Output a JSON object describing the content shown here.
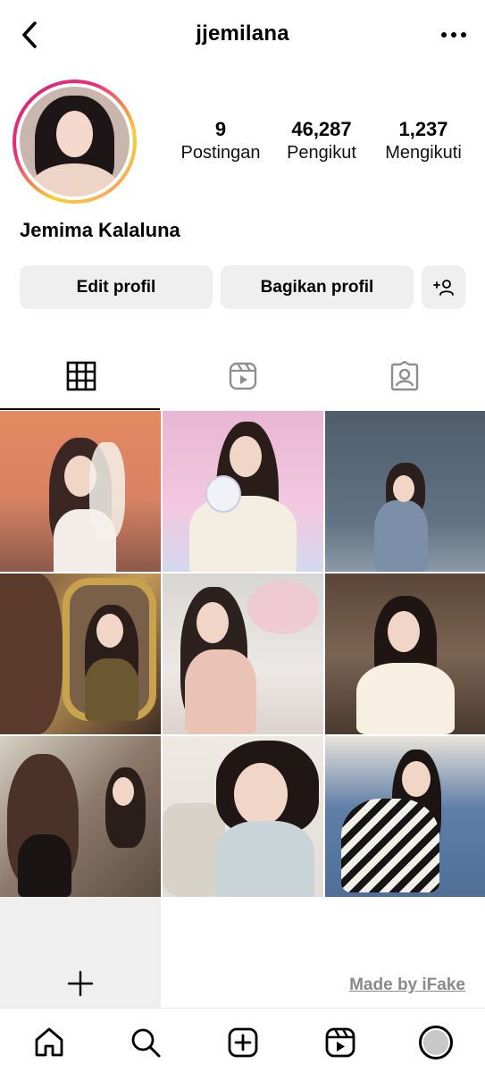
{
  "header": {
    "username": "jjemilana",
    "back_icon": "chevron-left-icon",
    "more_icon": "more-horizontal-icon"
  },
  "profile": {
    "full_name": "Jemima Kalaluna",
    "has_story_ring": true,
    "stats": {
      "posts": {
        "value": "9",
        "label": "Postingan"
      },
      "followers": {
        "value": "46,287",
        "label": "Pengikut"
      },
      "following": {
        "value": "1,237",
        "label": "Mengikuti"
      }
    }
  },
  "actions": {
    "edit_label": "Edit profil",
    "share_label": "Bagikan profil",
    "add_user_icon": "add-user-icon"
  },
  "tabs": [
    {
      "name": "posts",
      "icon": "grid-icon",
      "active": true
    },
    {
      "name": "reels",
      "icon": "reels-icon",
      "active": false
    },
    {
      "name": "tagged",
      "icon": "tagged-icon",
      "active": false
    }
  ],
  "posts": [
    {
      "index": 1,
      "description": "photo"
    },
    {
      "index": 2,
      "description": "photo"
    },
    {
      "index": 3,
      "description": "photo"
    },
    {
      "index": 4,
      "description": "photo"
    },
    {
      "index": 5,
      "description": "photo"
    },
    {
      "index": 6,
      "description": "photo"
    },
    {
      "index": 7,
      "description": "photo"
    },
    {
      "index": 8,
      "description": "photo"
    },
    {
      "index": 9,
      "description": "photo"
    }
  ],
  "add_post_icon": "plus-icon",
  "watermark": "Made by iFake",
  "bottom_nav": [
    {
      "name": "home",
      "icon": "home-icon"
    },
    {
      "name": "search",
      "icon": "search-icon"
    },
    {
      "name": "create",
      "icon": "plus-square-icon"
    },
    {
      "name": "reels",
      "icon": "reels-icon"
    },
    {
      "name": "profile",
      "icon": "profile-avatar-icon"
    }
  ],
  "colors": {
    "button_bg": "#efefef",
    "text": "#000000",
    "ring_gradient": [
      "#f9ce34",
      "#ee2a7b",
      "#d62976"
    ]
  }
}
